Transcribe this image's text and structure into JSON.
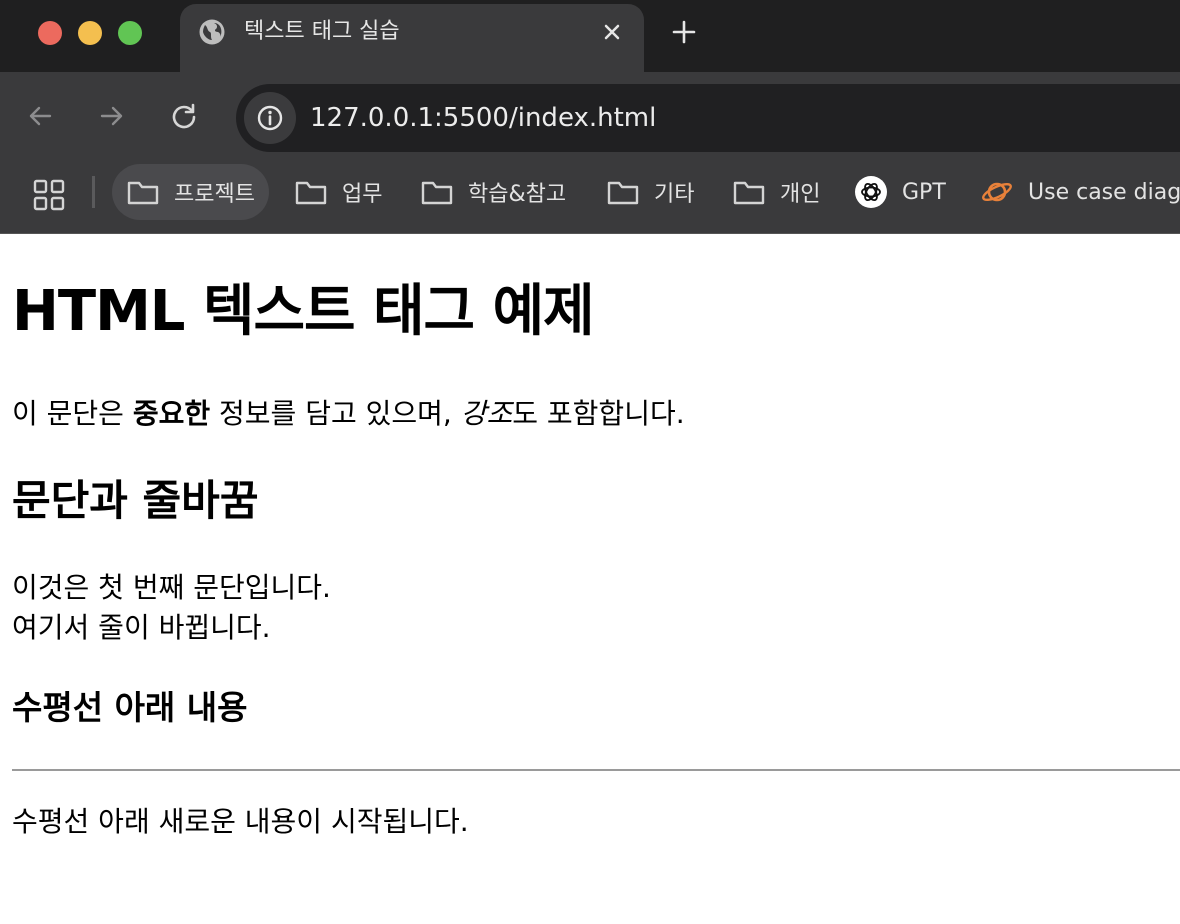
{
  "window": {
    "traffic_lights": [
      "close",
      "minimize",
      "zoom"
    ],
    "colors": {
      "red": "#ec6a5e",
      "yellow": "#f4bf4f",
      "green": "#61c554"
    }
  },
  "tab": {
    "title": "텍스트 태그 실습",
    "icon": "globe-icon"
  },
  "toolbar": {
    "url": "127.0.0.1:5500/index.html"
  },
  "bookmarks": [
    {
      "label": "프로젝트",
      "icon": "folder-icon"
    },
    {
      "label": "업무",
      "icon": "folder-icon"
    },
    {
      "label": "학습&참고",
      "icon": "folder-icon"
    },
    {
      "label": "기타",
      "icon": "folder-icon"
    },
    {
      "label": "개인",
      "icon": "folder-icon"
    },
    {
      "label": "GPT",
      "icon": "openai-icon"
    },
    {
      "label": "Use case diag",
      "icon": "planet-icon"
    }
  ],
  "content": {
    "h1": "HTML 텍스트 태그 예제",
    "p1": {
      "before": "이 문단은 ",
      "strong": "중요한",
      "middle": " 정보를 담고 있으며, ",
      "em": "강조",
      "after": "도 포함합니다."
    },
    "h2": "문단과 줄바꿈",
    "p2": {
      "line1": "이것은 첫 번째 문단입니다.",
      "line2": "여기서 줄이 바뀝니다."
    },
    "h3": "수평선 아래 내용",
    "p3": "수평선 아래 새로운 내용이 시작됩니다."
  }
}
